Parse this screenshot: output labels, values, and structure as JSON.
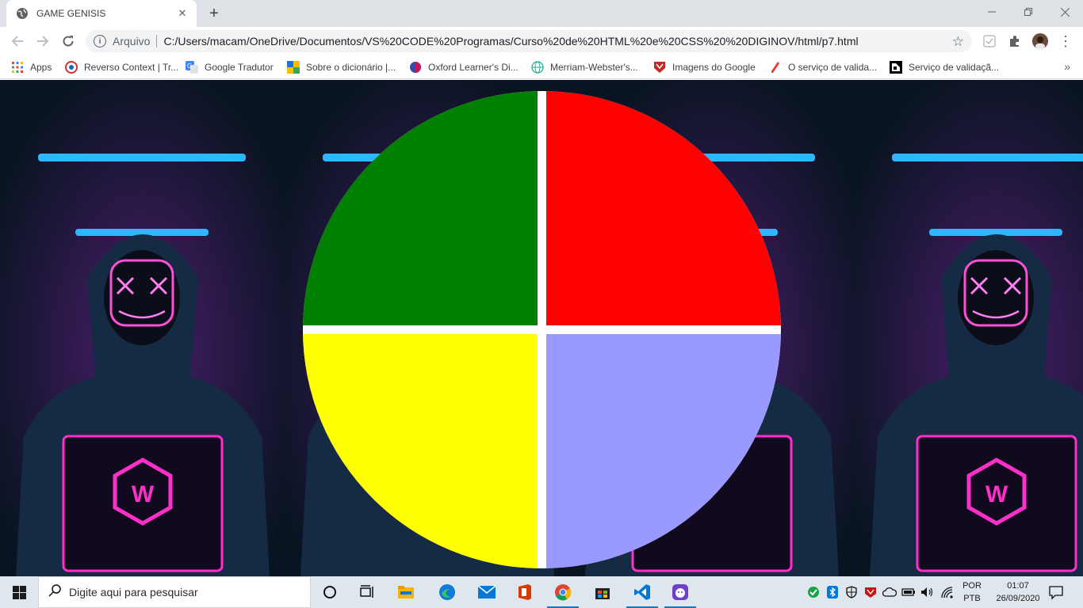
{
  "browser": {
    "tab": {
      "title": "GAME GENISIS",
      "icon": "globe-icon"
    },
    "address": {
      "scheme_label": "Arquivo",
      "url": "C:/Users/macam/OneDrive/Documentos/VS%20CODE%20Programas/Curso%20de%20HTML%20e%20CSS%20%20DIGINOV/html/p7.html"
    },
    "bookmarks": [
      {
        "label": "Apps",
        "icon": "apps-grid-icon"
      },
      {
        "label": "Reverso Context | Tr...",
        "icon": "reverso-icon"
      },
      {
        "label": "Google Tradutor",
        "icon": "google-translate-icon"
      },
      {
        "label": "Sobre o dicionário |...",
        "icon": "dictionary-icon"
      },
      {
        "label": "Oxford Learner's Di...",
        "icon": "oxford-icon"
      },
      {
        "label": "Merriam-Webster's...",
        "icon": "globe-icon"
      },
      {
        "label": "Imagens do Google",
        "icon": "shield-icon"
      },
      {
        "label": "O serviço de valida...",
        "icon": "pen-icon"
      },
      {
        "label": "Serviço de validaçã...",
        "icon": "validator-icon"
      }
    ]
  },
  "game": {
    "colors": {
      "green": "#008000",
      "red": "#ff0000",
      "yellow": "#ffff00",
      "blue": "#9999ff"
    }
  },
  "taskbar": {
    "search_placeholder": "Digite aqui para pesquisar",
    "language": [
      "POR",
      "PTB"
    ],
    "time": "01:07",
    "date": "26/09/2020"
  }
}
